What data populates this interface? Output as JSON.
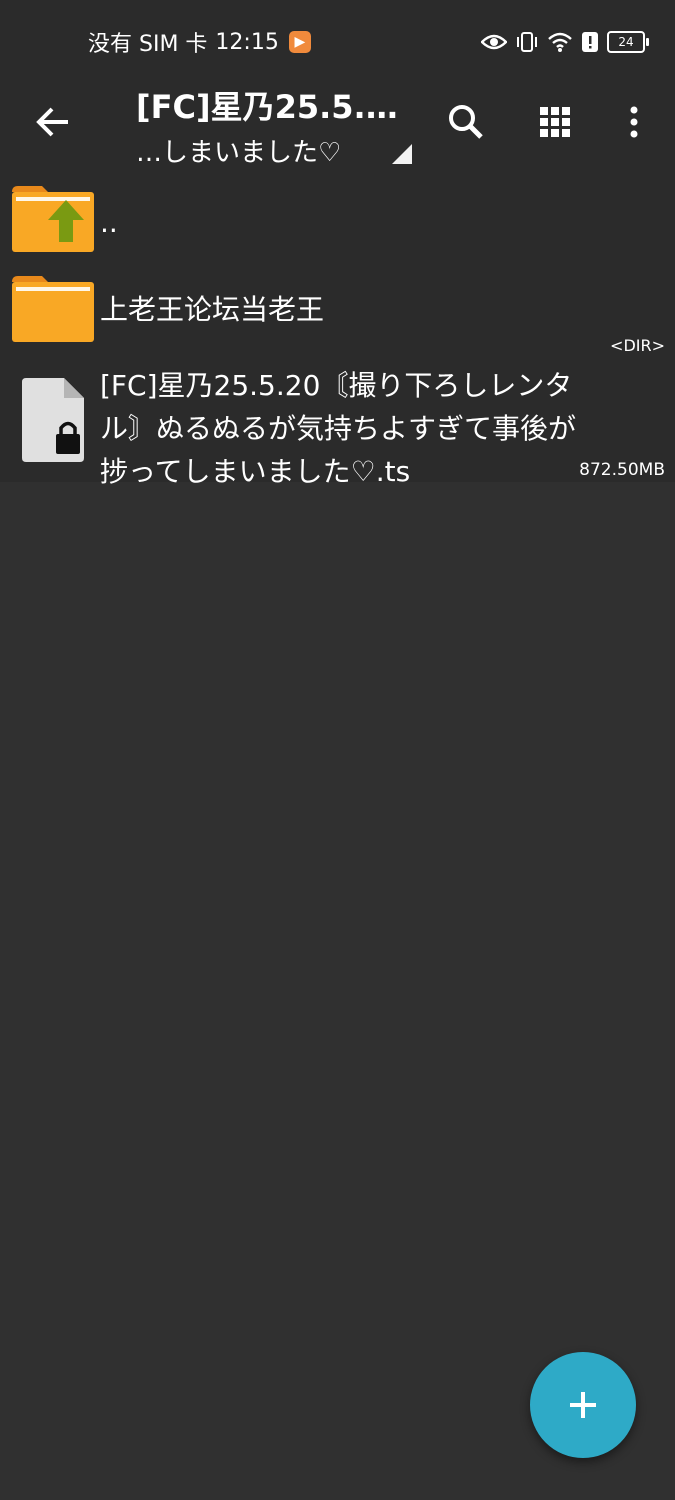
{
  "status_bar": {
    "carrier": "没有 SIM 卡",
    "time": "12:15",
    "battery": "24"
  },
  "app_bar": {
    "title": "[FC]星乃25.5.…",
    "subtitle": "…しまいました♡"
  },
  "files": {
    "up_label": "..",
    "dir_name": "上老王论坛当老王",
    "dir_meta": "<DIR>",
    "file_name": "[FC]星乃25.5.20〘撮り下ろしレンタル〙ぬるぬるが気持ちよすぎて事後が捗ってしまいました♡.ts",
    "file_size": "872.50MB"
  },
  "colors": {
    "background": "#303030",
    "bar": "#2b2b2b",
    "folder": "#f9a825",
    "up_arrow": "#7a9a12",
    "fab": "#2eaac7"
  }
}
